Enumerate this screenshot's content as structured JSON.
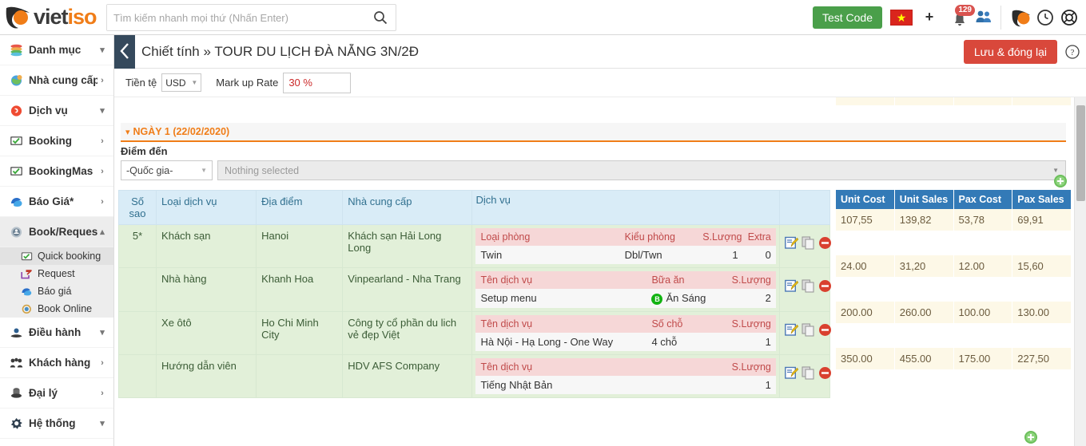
{
  "brand": {
    "name_part1": "viet",
    "name_part2": "iso"
  },
  "search": {
    "placeholder": "Tìm kiếm nhanh mọi thứ (Nhấn Enter)",
    "value": "",
    "icon": "search-icon"
  },
  "header": {
    "test_code_label": "Test Code",
    "flag": "vietnam-flag-icon",
    "plus_label": "+",
    "notification_count": "129",
    "people_icon": "people-icon",
    "avatar_icon": "avatar-icon",
    "clock_icon": "clock-icon",
    "lifebuoy_icon": "lifebuoy-icon"
  },
  "sidebar": {
    "items": [
      {
        "label": "Danh mục",
        "icon": "stack-icon",
        "chevron": "▾",
        "active": false
      },
      {
        "label": "Nhà cung cấp",
        "icon": "globe-icon",
        "chevron": "›",
        "active": false
      },
      {
        "label": "Dịch vụ",
        "icon": "service-icon",
        "chevron": "▾",
        "active": false
      },
      {
        "label": "Booking",
        "icon": "booking-icon",
        "chevron": "›",
        "active": false
      },
      {
        "label": "BookingMas",
        "icon": "booking-icon",
        "chevron": "›",
        "active": false
      },
      {
        "label": "Báo Giá*",
        "icon": "quote-icon",
        "chevron": "›",
        "active": false
      },
      {
        "label": "Book/Request",
        "icon": "book-request-icon",
        "chevron": "▴",
        "active": true
      }
    ],
    "subitems": [
      {
        "label": "Quick booking",
        "icon": "quick-booking-icon",
        "active": true
      },
      {
        "label": "Request",
        "icon": "request-icon",
        "active": false
      },
      {
        "label": "Báo giá",
        "icon": "quote-icon",
        "active": false
      },
      {
        "label": "Book Online",
        "icon": "book-online-icon",
        "active": false
      }
    ],
    "items_after": [
      {
        "label": "Điều hành",
        "icon": "operation-icon",
        "chevron": "▾"
      },
      {
        "label": "Khách hàng",
        "icon": "customer-icon",
        "chevron": "›"
      },
      {
        "label": "Đại lý",
        "icon": "agency-icon",
        "chevron": "›"
      },
      {
        "label": "Hệ thống",
        "icon": "system-icon",
        "chevron": "▾"
      }
    ]
  },
  "page": {
    "back_icon": "chevron-left-icon",
    "title": "Chiết tính » TOUR DU LỊCH ĐÀ NẴNG 3N/2Đ",
    "save_label": "Lưu & đóng lại",
    "help_icon": "help-icon"
  },
  "toolbar": {
    "currency_label": "Tiền tệ",
    "currency_value": "USD",
    "markup_label": "Mark up Rate",
    "markup_value": "30 %"
  },
  "day_section": {
    "caret": "▾",
    "title": "NGÀY 1 (22/02/2020)",
    "destination_label": "Điểm đến",
    "country_select": "-Quốc gia-",
    "multiselect_placeholder": "Nothing selected",
    "add_icon": "add-circle-icon"
  },
  "table": {
    "headers": [
      "Số sao",
      "Loại dịch vụ",
      "Địa điểm",
      "Nhà cung cấp",
      "Dịch vụ",
      ""
    ],
    "rows": [
      {
        "sao": "5*",
        "loai_dich_vu": "Khách sạn",
        "dia_diem": "Hanoi",
        "nha_cung_cap": "Khách sạn Hải Long Long",
        "inner_headers": [
          "Loại phòng",
          "Kiểu phòng",
          "S.Lượng",
          "Extra"
        ],
        "inner_values": [
          "Twin",
          "Dbl/Twn",
          "1",
          "0"
        ],
        "actions": [
          "edit-icon",
          "copy-icon",
          "delete-icon"
        ],
        "cost": {
          "unit_cost": "107,55",
          "unit_sales": "139,82",
          "pax_cost": "53,78",
          "pax_sales": "69,91"
        }
      },
      {
        "sao": "",
        "loai_dich_vu": "Nhà hàng",
        "dia_diem": "Khanh Hoa",
        "nha_cung_cap": "Vinpearland - Nha Trang",
        "inner_headers": [
          "Tên dịch vụ",
          "Bữa ăn",
          "S.Lượng"
        ],
        "inner_values": [
          "Setup menu",
          "Ăn Sáng",
          "2"
        ],
        "meal_badge": "B",
        "actions": [
          "edit-icon",
          "copy-icon",
          "delete-icon"
        ],
        "cost": {
          "unit_cost": "24.00",
          "unit_sales": "31,20",
          "pax_cost": "12.00",
          "pax_sales": "15,60"
        }
      },
      {
        "sao": "",
        "loai_dich_vu": "Xe ôtô",
        "dia_diem": "Ho Chi Minh City",
        "nha_cung_cap": "Công ty cổ phần du lich vẻ đẹp Việt",
        "inner_headers": [
          "Tên dịch vụ",
          "Số chỗ",
          "S.Lượng"
        ],
        "inner_values": [
          "Hà Nội - Hạ Long - One Way",
          "4 chỗ",
          "1"
        ],
        "actions": [
          "edit-icon",
          "copy-icon",
          "delete-icon"
        ],
        "cost": {
          "unit_cost": "200.00",
          "unit_sales": "260.00",
          "pax_cost": "100.00",
          "pax_sales": "130.00"
        }
      },
      {
        "sao": "",
        "loai_dich_vu": "Hướng dẫn viên",
        "dia_diem": "",
        "nha_cung_cap": "HDV AFS Company",
        "inner_headers": [
          "Tên dịch vụ",
          "S.Lượng"
        ],
        "inner_values": [
          "Tiếng Nhật Bản",
          "1"
        ],
        "actions": [
          "edit-icon",
          "copy-icon",
          "delete-icon"
        ],
        "cost": {
          "unit_cost": "350.00",
          "unit_sales": "455.00",
          "pax_cost": "175.00",
          "pax_sales": "227,50"
        }
      }
    ]
  },
  "cost_panel": {
    "headers": [
      "Unit Cost",
      "Unit Sales",
      "Pax Cost",
      "Pax Sales"
    ]
  },
  "footer": {
    "add_icon": "add-circle-icon"
  },
  "colors": {
    "brand_orange": "#f07d18",
    "accent_blue": "#337ab7",
    "save_red": "#d9483b",
    "test_green": "#4a9f4a",
    "row_green": "#e2f0d9",
    "cost_cream": "#fdf8e7"
  }
}
